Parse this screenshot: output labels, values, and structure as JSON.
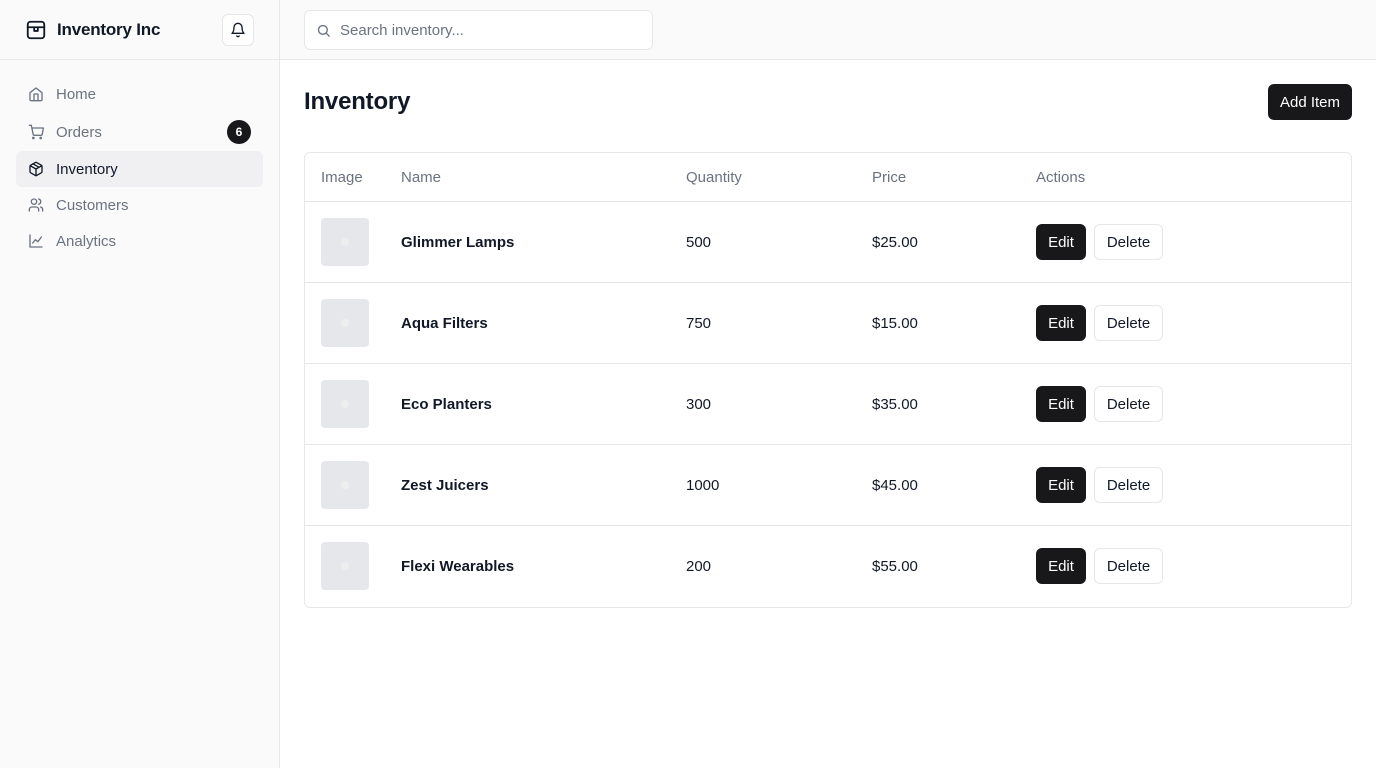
{
  "app": {
    "brand": "Inventory Inc"
  },
  "search": {
    "placeholder": "Search inventory..."
  },
  "nav": [
    {
      "label": "Home",
      "icon": "home-icon"
    },
    {
      "label": "Orders",
      "icon": "cart-icon",
      "badge": "6"
    },
    {
      "label": "Inventory",
      "icon": "package-icon",
      "active": true
    },
    {
      "label": "Customers",
      "icon": "users-icon"
    },
    {
      "label": "Analytics",
      "icon": "chart-line-icon"
    }
  ],
  "page": {
    "title": "Inventory",
    "add_label": "Add Item"
  },
  "table": {
    "headers": [
      "Image",
      "Name",
      "Quantity",
      "Price",
      "Actions"
    ],
    "edit_label": "Edit",
    "delete_label": "Delete",
    "rows": [
      {
        "name": "Glimmer Lamps",
        "quantity": "500",
        "price": "$25.00"
      },
      {
        "name": "Aqua Filters",
        "quantity": "750",
        "price": "$15.00"
      },
      {
        "name": "Eco Planters",
        "quantity": "300",
        "price": "$35.00"
      },
      {
        "name": "Zest Juicers",
        "quantity": "1000",
        "price": "$45.00"
      },
      {
        "name": "Flexi Wearables",
        "quantity": "200",
        "price": "$55.00"
      }
    ]
  },
  "colors": {
    "accent": "#18181b",
    "muted": "#6b7280",
    "border": "#e5e7eb",
    "sidebar_bg": "#fafafa"
  }
}
